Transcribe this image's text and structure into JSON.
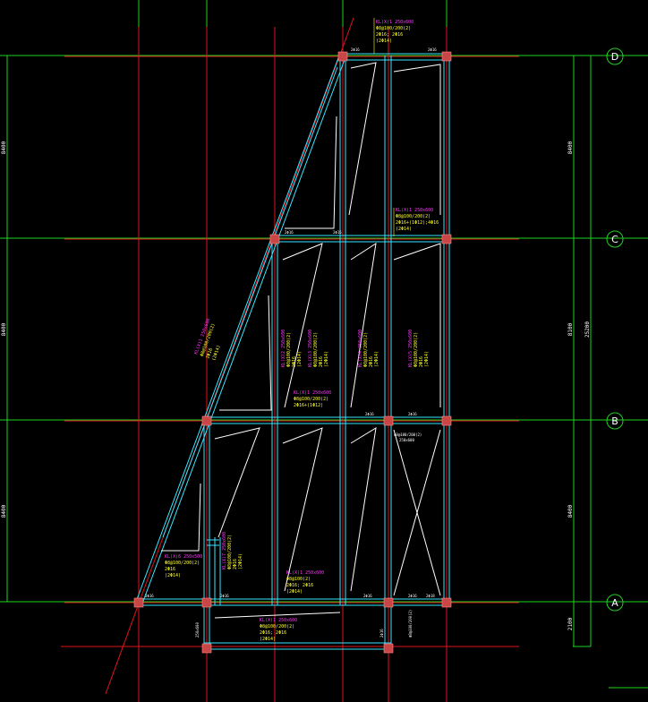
{
  "axes": {
    "rows": [
      {
        "label": "D"
      },
      {
        "label": "C"
      },
      {
        "label": "B"
      },
      {
        "label": "A"
      }
    ]
  },
  "dimensions": {
    "left_spans": [
      "8400",
      "8400",
      "8400"
    ],
    "right_spans": [
      "8400",
      "8100",
      "8400"
    ],
    "right_total": "25200",
    "right_bottom": "2100"
  },
  "annotations": [
    {
      "id": "top",
      "lines": [
        "KL(X)1 250x600",
        "Φ8@100/200(2)",
        "2Φ16; 2Φ16",
        "(2Φ14)"
      ]
    },
    {
      "id": "row-c-right",
      "lines": [
        "KL(X)1 250x600",
        "Φ8@100/200(2)",
        "2Φ16+(1Φ12);4Φ16",
        "(2Φ14)"
      ]
    },
    {
      "id": "diag",
      "lines": [
        "KL(X)1 250x600",
        "Φ8@100/200(2)",
        "2Φ16",
        "(2Φ14)"
      ]
    },
    {
      "id": "mid1",
      "lines": [
        "KL(X)2 250x600",
        "Φ8@100/200(2)",
        "2Φ16",
        "(2Φ14)"
      ]
    },
    {
      "id": "mid2",
      "lines": [
        "KL(X)3 250x600",
        "Φ8@100/200(2)",
        "2Φ16",
        "(2Φ14)"
      ]
    },
    {
      "id": "mid3",
      "lines": [
        "KL(X)4 250x600",
        "Φ8@100/200(2)",
        "2Φ16",
        "(2Φ14)"
      ]
    },
    {
      "id": "mid4",
      "lines": [
        "KL(X)5 250x600",
        "Φ8@100/200(2)",
        "2Φ16",
        "(2Φ14)"
      ]
    },
    {
      "id": "row-b",
      "lines": [
        "KL(X)1 250x600",
        "Φ8@100/200(2)",
        "2Φ16+(1Φ12)"
      ]
    },
    {
      "id": "low-left",
      "lines": [
        "KL(X)6 250x500",
        "Φ8@100/200(2)",
        "2Φ16",
        "(2Φ14)"
      ]
    },
    {
      "id": "low-left2",
      "lines": [
        "KL(X)7 250x600",
        "Φ8@100/200(2)",
        "2Φ16",
        "(2Φ14)"
      ]
    },
    {
      "id": "low-mid",
      "lines": [
        "KL(X)1 250x600",
        "Φ8@100(2)",
        "2Φ16; 2Φ16",
        "(2Φ14)"
      ]
    },
    {
      "id": "bottom",
      "lines": [
        "KL(X)1 250x600",
        "Φ8@100/200(2)",
        "2Φ16; 2Φ16",
        "(2Φ14)"
      ]
    },
    {
      "id": "b-right",
      "lines": [
        "Φ8@100/200(2)",
        "250x600"
      ]
    }
  ],
  "small_labels": {
    "rebar": "2Φ16",
    "rebar2": "2Φ18",
    "size": "250x600",
    "stirrup": "Φ8@100/200(2)"
  },
  "colors": {
    "background": "#000000",
    "grid_red": "#e0141e",
    "grid_green": "#1ed21e",
    "beam": "#37e6ff",
    "column": "#c84646",
    "tag_magenta": "#ff32ff",
    "tag_yellow": "#ffff28"
  }
}
